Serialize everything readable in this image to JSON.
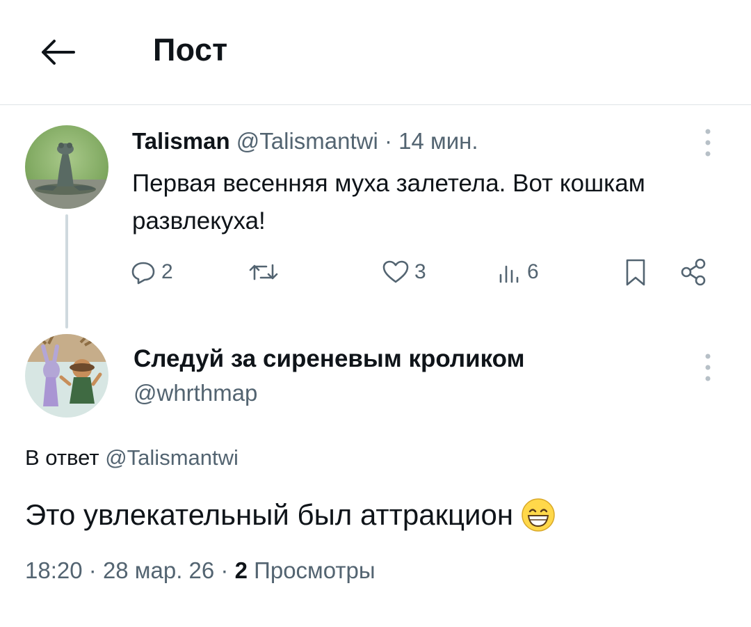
{
  "header": {
    "title": "Пост",
    "back_icon": "arrow-left-icon"
  },
  "tweet1": {
    "author_name": "Talisman",
    "handle": "@Talismantwi",
    "separator": "·",
    "time": "14 мин.",
    "text": "Первая весенняя муха залетела. Вот кошкам развлекуха!",
    "actions": {
      "replies": "2",
      "retweets": "",
      "likes": "3",
      "views": "6"
    }
  },
  "tweet2": {
    "author_name": "Следуй за сиреневым кроликом",
    "handle": "@whrthmap",
    "reply_prefix": "В ответ",
    "reply_handle": "@Talismantwi",
    "text": "Это увлекательный был аттракцион",
    "emoji": "grinning-face-icon",
    "time": "18:20",
    "sep": "·",
    "date": "28 мар. 26",
    "views_count": "2",
    "views_label": "Просмотры"
  },
  "colors": {
    "text_primary": "#0f1419",
    "text_secondary": "#536471",
    "divider": "#dfe3e6",
    "thread_line": "#cfd9de"
  }
}
